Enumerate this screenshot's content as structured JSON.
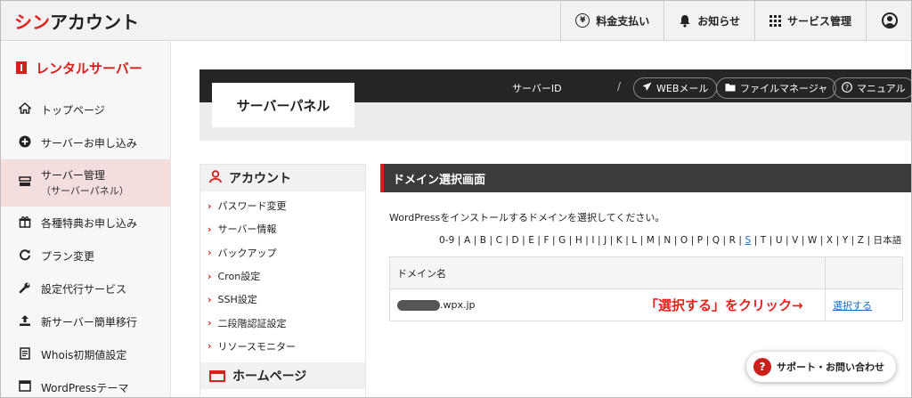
{
  "header": {
    "logo_accent": "シン",
    "logo_rest": "アカウント",
    "nav": [
      {
        "label": "料金支払い",
        "icon": "yen-icon"
      },
      {
        "label": "お知らせ",
        "icon": "bell-icon"
      },
      {
        "label": "サービス管理",
        "icon": "grid-icon"
      }
    ],
    "user_icon": "user-icon"
  },
  "sidebar": {
    "title": "レンタルサーバー",
    "items": [
      {
        "label": "トップページ",
        "icon": "home-icon"
      },
      {
        "label": "サーバーお申し込み",
        "icon": "plus-circle-icon"
      },
      {
        "label": "サーバー管理",
        "sub": "（サーバーパネル）",
        "icon": "server-icon",
        "active": true
      },
      {
        "label": "各種特典お申し込み",
        "icon": "gift-icon"
      },
      {
        "label": "プラン変更",
        "icon": "refresh-icon"
      },
      {
        "label": "設定代行サービス",
        "icon": "wrench-icon"
      },
      {
        "label": "新サーバー簡単移行",
        "icon": "upload-icon"
      },
      {
        "label": "Whois初期値設定",
        "icon": "document-icon"
      },
      {
        "label": "WordPressテーマ",
        "icon": "window-icon"
      }
    ]
  },
  "panel": {
    "title": "サーバーパネル",
    "server_id_label": "サーバーID",
    "slash": "/",
    "buttons": {
      "web_mail": "WEBメール",
      "file_manager": "ファイルマネージャ",
      "manual": "マニュアル"
    }
  },
  "account": {
    "title": "アカウント",
    "links": [
      "パスワード変更",
      "サーバー情報",
      "バックアップ",
      "Cron設定",
      "SSH設定",
      "二段階認証設定",
      "リソースモニター"
    ],
    "home_title": "ホームページ"
  },
  "domain": {
    "title": "ドメイン選択画面",
    "instruction": "WordPressをインストールするドメインを選択してください。",
    "alpha_before": "0-9 | A | B | C | D | E | F | G | H | I | J | K | L | M | N | O | P | Q | R | ",
    "alpha_link": "S",
    "alpha_after": " | T | U | V | W | X | Y | Z | 日本語",
    "col_header": "ドメイン名",
    "row_domain_suffix": ".wpx.jp",
    "select_link": "選択する",
    "annotation": "「選択する」をクリック→"
  },
  "support": {
    "label": "サポート・お問い合わせ"
  },
  "colors": {
    "accent": "#d3211c",
    "dark": "#252525",
    "link": "#1a6fc0"
  }
}
